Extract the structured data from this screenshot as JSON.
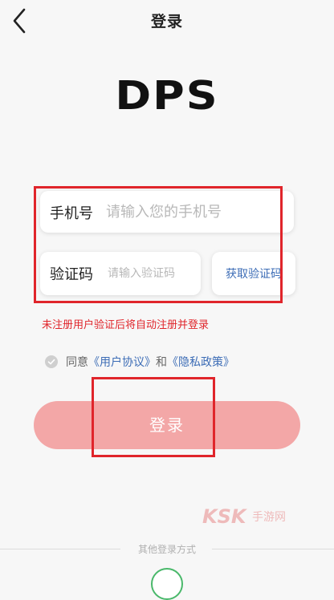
{
  "header": {
    "title": "登录"
  },
  "brand": {
    "logo_text": "DPS"
  },
  "form": {
    "phone": {
      "label": "手机号",
      "placeholder": "请输入您的手机号",
      "value": ""
    },
    "code": {
      "label": "验证码",
      "placeholder": "请输入验证码",
      "value": ""
    },
    "get_code_label": "获取验证码"
  },
  "notice": "未注册用户验证后将自动注册并登录",
  "agreement": {
    "prefix": "同意",
    "user_agreement": "《用户协议》",
    "conjunction": "和",
    "privacy_policy": "《隐私政策》",
    "checked": false
  },
  "login_button_label": "登录",
  "watermark": {
    "letters": "KSK",
    "sub": "手游网"
  },
  "other_login": {
    "label": "其他登录方式",
    "icons": [
      "wechat-icon"
    ]
  },
  "colors": {
    "accent_red": "#e0252b",
    "link_blue": "#3d6db6",
    "login_button": "#f3a7a7",
    "background": "#f7f7f7"
  }
}
